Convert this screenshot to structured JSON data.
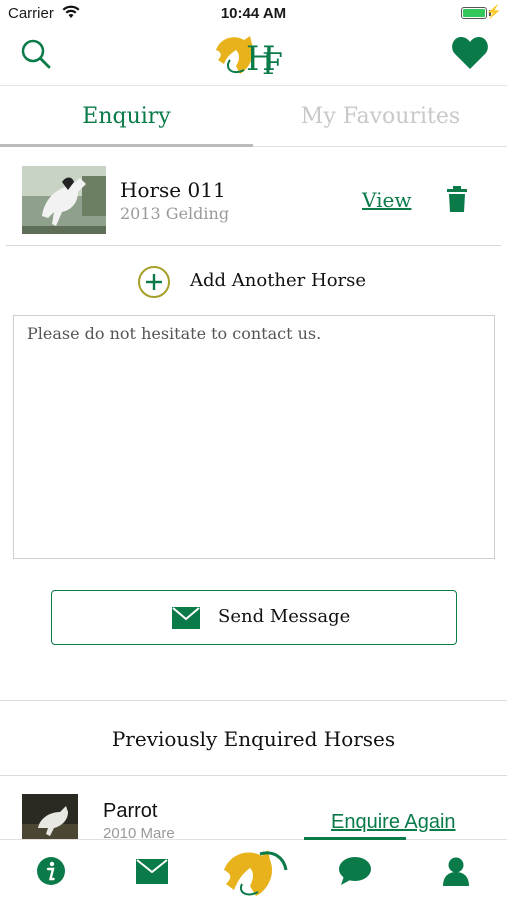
{
  "status_bar": {
    "carrier": "Carrier",
    "time": "10:44 AM",
    "battery_level": 1.0
  },
  "header": {
    "icons": [
      "search-icon",
      "hf-logo",
      "heart-icon"
    ]
  },
  "tabs": [
    {
      "label": "Enquiry",
      "active": true
    },
    {
      "label": "My Favourites",
      "active": false
    }
  ],
  "enquiry_horse": {
    "name": "Horse 011",
    "details": "2013 Gelding",
    "view_label": "View"
  },
  "add_horse": {
    "label": "Add Another Horse"
  },
  "message": {
    "value": "Please do not hesitate to contact us."
  },
  "send_button": {
    "label": "Send Message"
  },
  "previous": {
    "title": "Previously Enquired Horses",
    "items": [
      {
        "name": "Parrot",
        "details": "2010 Mare",
        "action": "Enquire Again"
      }
    ]
  },
  "tabbar": {
    "items": [
      "info-icon",
      "mail-icon",
      "home-logo",
      "chat-icon",
      "profile-icon"
    ]
  },
  "colors": {
    "brand_green": "#0a7a49",
    "logo_gold": "#e7b21b",
    "inactive_tab": "#c8c8c8"
  }
}
